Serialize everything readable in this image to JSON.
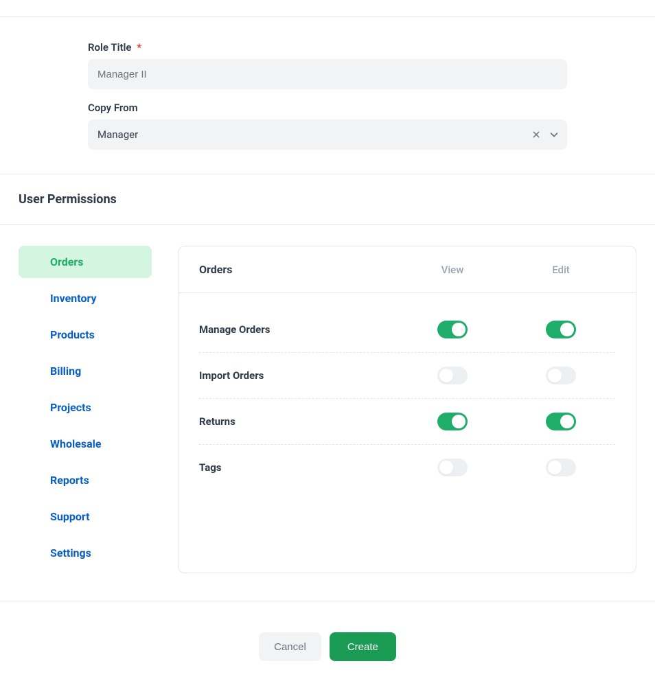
{
  "form": {
    "roleTitleLabel": "Role Title",
    "roleTitleRequired": "*",
    "roleTitlePlaceholder": "Manager II",
    "copyFromLabel": "Copy From",
    "copyFromValue": "Manager"
  },
  "section": {
    "title": "User Permissions"
  },
  "sidebar": {
    "items": [
      {
        "label": "Orders",
        "active": true
      },
      {
        "label": "Inventory",
        "active": false
      },
      {
        "label": "Products",
        "active": false
      },
      {
        "label": "Billing",
        "active": false
      },
      {
        "label": "Projects",
        "active": false
      },
      {
        "label": "Wholesale",
        "active": false
      },
      {
        "label": "Reports",
        "active": false
      },
      {
        "label": "Support",
        "active": false
      },
      {
        "label": "Settings",
        "active": false
      }
    ]
  },
  "panel": {
    "title": "Orders",
    "columns": {
      "view": "View",
      "edit": "Edit"
    },
    "rows": [
      {
        "label": "Manage Orders",
        "view": true,
        "edit": true
      },
      {
        "label": "Import Orders",
        "view": false,
        "edit": false
      },
      {
        "label": "Returns",
        "view": true,
        "edit": true
      },
      {
        "label": "Tags",
        "view": false,
        "edit": false
      }
    ]
  },
  "footer": {
    "cancel": "Cancel",
    "create": "Create"
  }
}
